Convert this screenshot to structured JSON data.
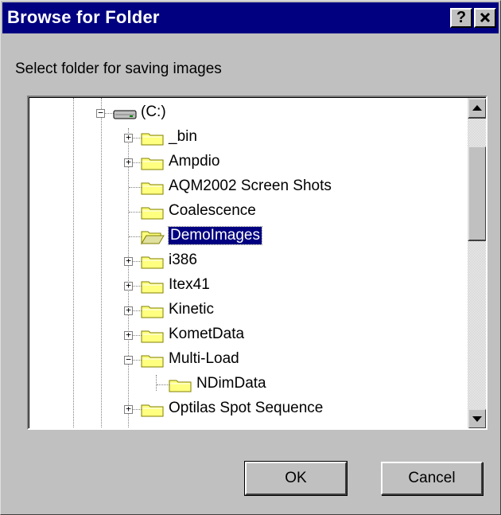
{
  "dialog": {
    "title": "Browse for Folder",
    "help_label": "?",
    "close_label": "✕",
    "instruction": "Select folder for saving images"
  },
  "tree": {
    "items": [
      {
        "label": "(C:)",
        "icon": "drive-icon",
        "expander": "minus"
      },
      {
        "label": "_bin",
        "icon": "folder-icon",
        "expander": "plus"
      },
      {
        "label": "Ampdio",
        "icon": "folder-icon",
        "expander": "plus"
      },
      {
        "label": "AQM2002 Screen Shots",
        "icon": "folder-icon",
        "expander": "none"
      },
      {
        "label": "Coalescence",
        "icon": "folder-icon",
        "expander": "none"
      },
      {
        "label": "DemoImages",
        "icon": "open-folder-icon",
        "expander": "none",
        "selected": true
      },
      {
        "label": "i386",
        "icon": "folder-icon",
        "expander": "plus"
      },
      {
        "label": "Itex41",
        "icon": "folder-icon",
        "expander": "plus"
      },
      {
        "label": "Kinetic",
        "icon": "folder-icon",
        "expander": "plus"
      },
      {
        "label": "KometData",
        "icon": "folder-icon",
        "expander": "plus"
      },
      {
        "label": "Multi-Load",
        "icon": "folder-icon",
        "expander": "minus"
      },
      {
        "label": "NDimData",
        "icon": "folder-icon",
        "expander": "none"
      },
      {
        "label": "Optilas Spot Sequence",
        "icon": "folder-icon",
        "expander": "plus"
      }
    ]
  },
  "buttons": {
    "ok_label": "OK",
    "cancel_label": "Cancel"
  },
  "colors": {
    "titlebar": "#000080",
    "dialog_face": "#c0c0c0",
    "selection": "#000080",
    "folder": "#ffff80"
  }
}
